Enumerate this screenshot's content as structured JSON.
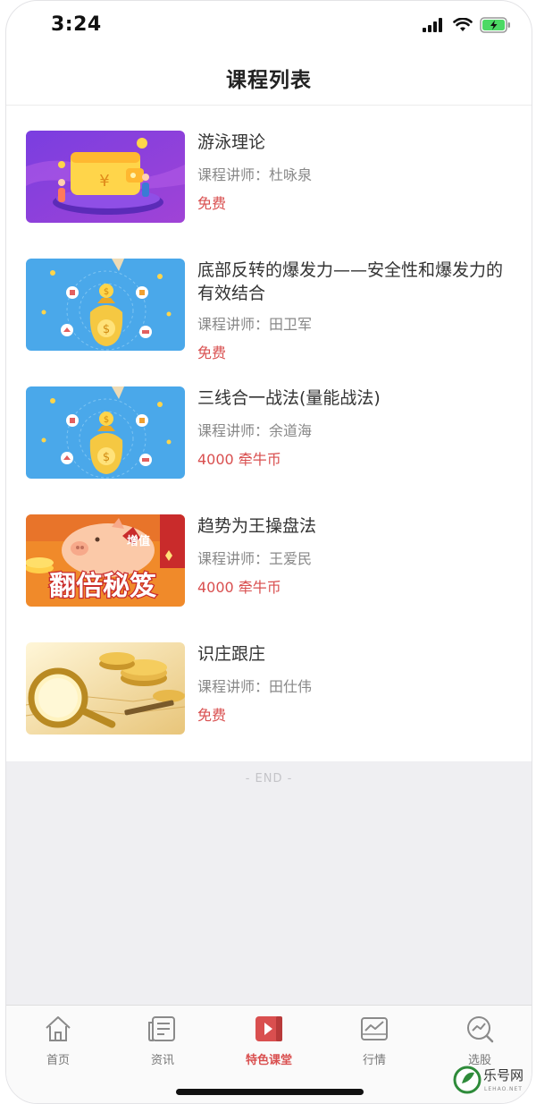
{
  "status_bar": {
    "time": "3:24"
  },
  "header": {
    "title": "课程列表"
  },
  "courses": [
    {
      "title": "游泳理论",
      "teacher": "课程讲师：杜咏泉",
      "price": "免费",
      "thumb_icon": "wallet-illustration"
    },
    {
      "title": "底部反转的爆发力——安全性和爆发力的有效结合",
      "teacher": "课程讲师：田卫军",
      "price": "免费",
      "thumb_icon": "money-bag-illustration"
    },
    {
      "title": "三线合一战法(量能战法)",
      "teacher": "课程讲师：余道海",
      "price": "4000 牵牛币",
      "thumb_icon": "money-bag-illustration"
    },
    {
      "title": "趋势为王操盘法",
      "teacher": "课程讲师：王爱民",
      "price": "4000 牵牛币",
      "thumb_icon": "piggy-bank-illustration",
      "thumb_text_main": "翻倍秘笈",
      "thumb_text_tag": "增值"
    },
    {
      "title": "识庄跟庄",
      "teacher": "课程讲师：田仕伟",
      "price": "免费",
      "thumb_icon": "gold-coins-illustration"
    }
  ],
  "footer": {
    "end_label": "- END -"
  },
  "tab_bar": {
    "tabs": [
      {
        "label": "首页",
        "icon": "home-icon"
      },
      {
        "label": "资讯",
        "icon": "news-icon"
      },
      {
        "label": "特色课堂",
        "icon": "video-class-icon",
        "active": true
      },
      {
        "label": "行情",
        "icon": "market-chart-icon"
      },
      {
        "label": "选股",
        "icon": "stock-pick-icon"
      }
    ]
  },
  "watermark": {
    "text": "乐号网",
    "subtext": "LEHAO.NET"
  },
  "colors": {
    "accent": "#d94f4f",
    "title_text": "#333333",
    "sub_text": "#888888",
    "end_area": "#efeff2"
  }
}
